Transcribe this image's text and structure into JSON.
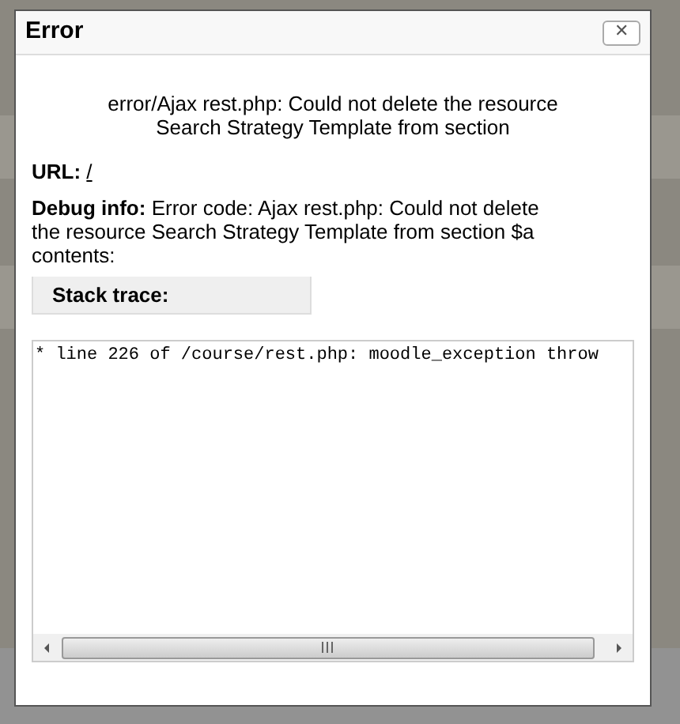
{
  "dialog": {
    "title": "Error",
    "close": "✕",
    "message": "error/Ajax rest.php: Could not delete the resource Search Strategy Template from section",
    "url_label": "URL:",
    "url": "/",
    "debug_label": "Debug info:",
    "debug_text": "Error code: Ajax rest.php: Could not delete the resource Search Strategy Template from section $a contents:",
    "stack_label": "Stack trace:",
    "trace": "* line 226 of /course/rest.php: moodle_exception throw"
  }
}
